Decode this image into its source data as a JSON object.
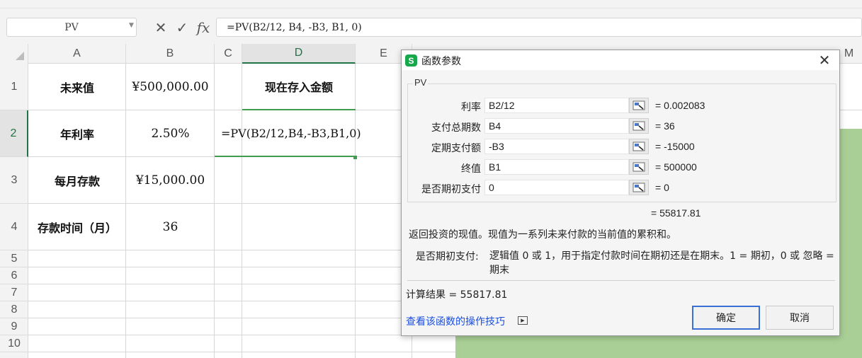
{
  "formula_bar": {
    "name_box": "PV",
    "cancel_glyph": "✕",
    "enter_glyph": "✓",
    "fx_glyph": "fx",
    "formula": "=PV(B2/12, B4, -B3, B1, 0)"
  },
  "sheet": {
    "columns": [
      "A",
      "B",
      "C",
      "D",
      "E",
      "M"
    ],
    "rows": [
      "1",
      "2",
      "3",
      "4",
      "5",
      "6",
      "7",
      "8",
      "9",
      "10"
    ],
    "cells": {
      "A1": "未来值",
      "B1": "¥500,000.00",
      "D1": "现在存入金额",
      "A2": "年利率",
      "B2": "2.50%",
      "D2": "=PV(B2/12,B4,-B3,B1,0)",
      "A3": "每月存款",
      "B3": "¥15,000.00",
      "A4": "存款时间（月）",
      "B4": "36"
    },
    "selected_cell": "D2",
    "colors": {
      "selection": "#3f9d4d",
      "background_fill": "#a9cf96"
    }
  },
  "dialog": {
    "logo": "S",
    "title": "函数参数",
    "close_glyph": "✕",
    "function_name": "PV",
    "args": [
      {
        "label": "利率",
        "input": "B2/12",
        "value": "= 0.002083"
      },
      {
        "label": "支付总期数",
        "input": "B4",
        "value": "= 36"
      },
      {
        "label": "定期支付额",
        "input": "-B3",
        "value": "= -15000"
      },
      {
        "label": "终值",
        "input": "B1",
        "value": "= 500000"
      },
      {
        "label": "是否期初支付",
        "input": "0",
        "value": "= 0"
      }
    ],
    "formula_result": "= 55817.81",
    "description": "返回投资的现值。现值为一系列未来付款的当前值的累积和。",
    "arg_desc_name": "是否期初支付:",
    "arg_desc_text": "逻辑值 0 或 1，用于指定付款时间在期初还是在期末。1 = 期初，0 或 忽略 = 期末",
    "calc_result": "计算结果 = 55817.81",
    "help_link": "查看该函数的操作技巧",
    "ok_label": "确定",
    "cancel_label": "取消"
  }
}
